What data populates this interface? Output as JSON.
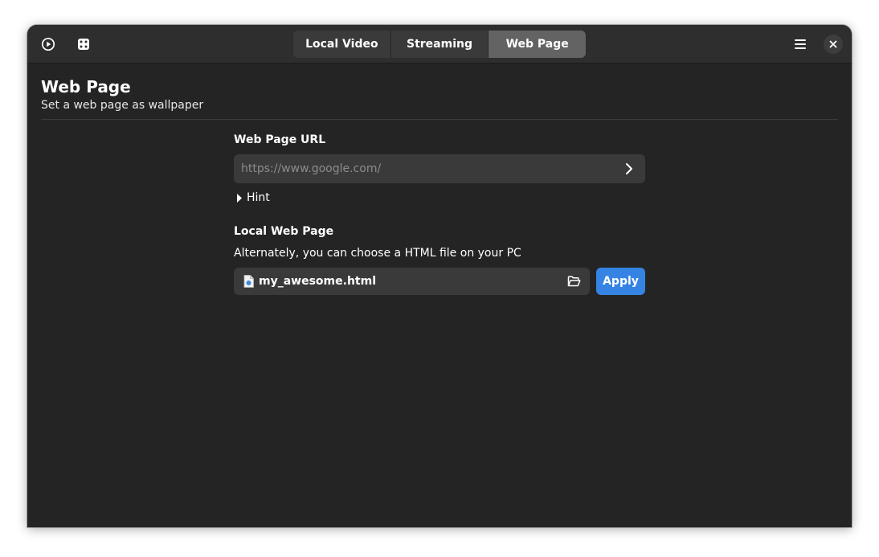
{
  "header": {
    "left_icons": [
      "play-circle-icon",
      "dice-icon"
    ],
    "tabs": [
      {
        "label": "Local Video",
        "active": false
      },
      {
        "label": "Streaming",
        "active": false
      },
      {
        "label": "Web Page",
        "active": true
      }
    ],
    "right_icons": [
      "hamburger-menu-icon",
      "close-icon"
    ]
  },
  "page": {
    "title": "Web Page",
    "subtitle": "Set a web page as wallpaper"
  },
  "url_section": {
    "label": "Web Page URL",
    "value": "",
    "placeholder": "https://www.google.com/",
    "go_icon": "chevron-right-icon",
    "hint_label": "Hint",
    "hint_expanded": false
  },
  "local_section": {
    "label": "Local Web Page",
    "description": "Alternately, you can choose a HTML file on your PC",
    "file_name": "my_awesome.html",
    "file_icon": "html-file-icon",
    "folder_icon": "folder-open-icon",
    "apply_label": "Apply"
  },
  "colors": {
    "window_bg": "#242424",
    "headerbar_bg": "#2e2e2e",
    "accent": "#3584e4",
    "active_tab_bg": "#636363",
    "tab_bg": "#3a3a3a"
  }
}
